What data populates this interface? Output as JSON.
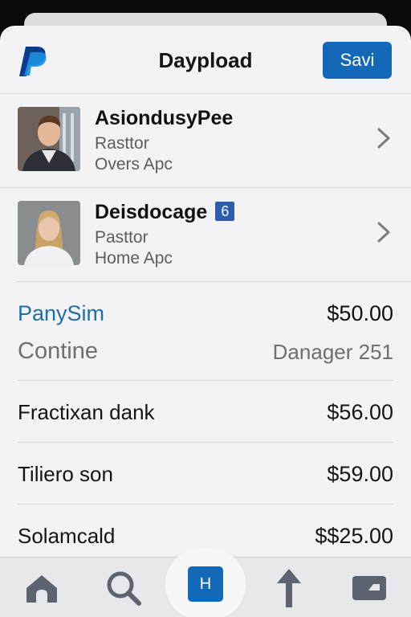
{
  "header": {
    "title": "Daypload",
    "save_label": "Savi",
    "logo_icon": "paypal-logo-icon",
    "brand_color": "#1368b8"
  },
  "contacts": [
    {
      "name": "AsiondusyPee",
      "line1": "Rasttor",
      "line2": "Overs Apc",
      "avatar_icon": "man-avatar",
      "badge": null
    },
    {
      "name": "Deisdocage",
      "line1": "Pasttor",
      "line2": "Home Apc",
      "avatar_icon": "woman-avatar",
      "badge": "6"
    }
  ],
  "payment": {
    "label": "PanySim",
    "amount": "$50.00",
    "sub_label": "Contine",
    "sub_right": "Danager 251"
  },
  "transactions": [
    {
      "label": "Fractixan dank",
      "amount": "$56.00"
    },
    {
      "label": "Tiliero son",
      "amount": "$59.00"
    },
    {
      "label": "Solamcald",
      "amount": "$$25.00"
    }
  ],
  "tabbar": {
    "items": [
      {
        "icon": "home-icon"
      },
      {
        "icon": "search-icon"
      },
      {
        "icon": "h-icon",
        "text": "H",
        "active": true
      },
      {
        "icon": "up-arrow-icon"
      },
      {
        "icon": "wallet-icon"
      }
    ]
  }
}
